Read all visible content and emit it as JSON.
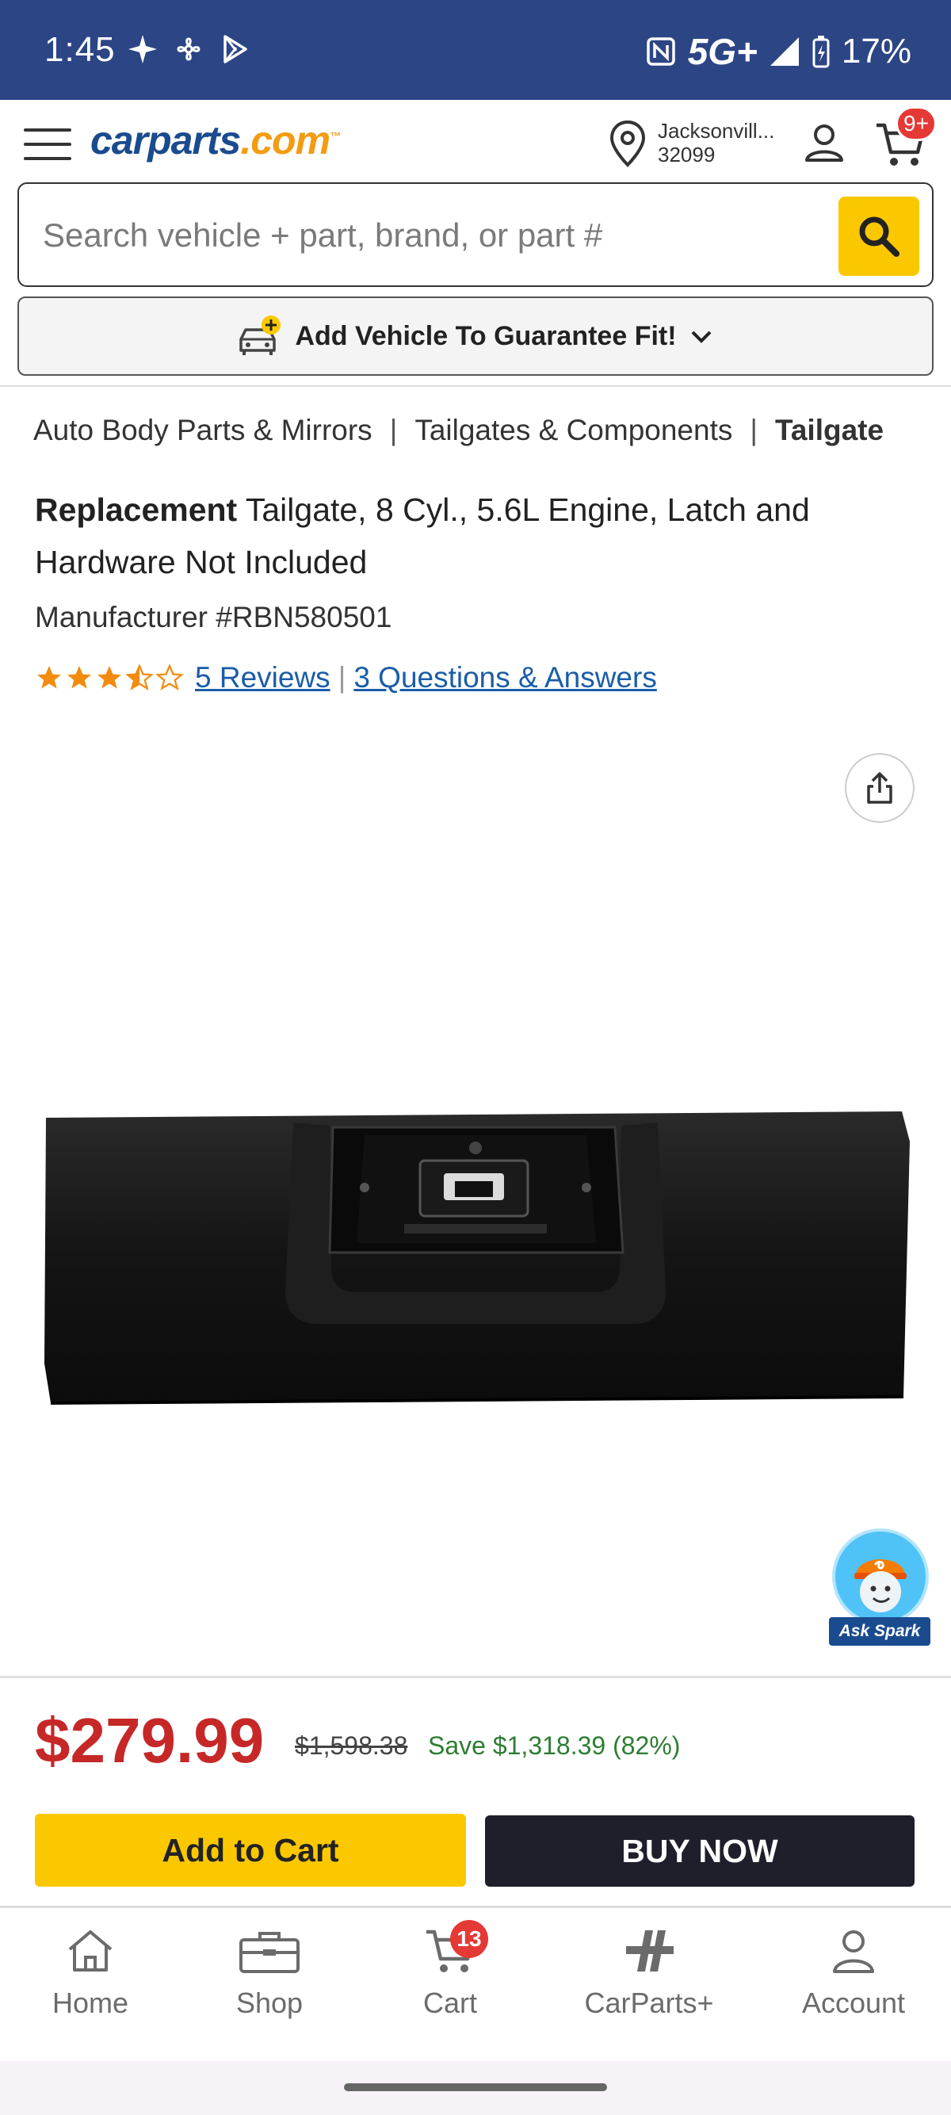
{
  "status_bar": {
    "time": "1:45",
    "network": "5G+",
    "battery": "17%"
  },
  "header": {
    "logo_car": "carparts",
    "logo_com": ".com",
    "logo_tm": "™",
    "location_city": "Jacksonvill...",
    "location_zip": "32099",
    "cart_count": "9+"
  },
  "search": {
    "placeholder": "Search vehicle + part, brand, or part #"
  },
  "vehicle_bar": {
    "label": "Add Vehicle To Guarantee Fit!"
  },
  "breadcrumb": {
    "items": [
      "Auto Body Parts & Mirrors",
      "Tailgates & Components",
      "Tailgate"
    ],
    "separator": "|"
  },
  "product": {
    "title_bold": "Replacement",
    "title_rest": " Tailgate, 8 Cyl., 5.6L Engine, Latch and Hardware Not Included",
    "manufacturer": "Manufacturer #RBN580501",
    "rating": 3.5,
    "reviews_link": "5 Reviews",
    "qa_link": "3 Questions & Answers"
  },
  "spark": {
    "label": "Ask Spark"
  },
  "pricing": {
    "price": "$279.99",
    "old_price": "$1,598.38",
    "save": "Save $1,318.39 (82%)"
  },
  "actions": {
    "add_to_cart": "Add to Cart",
    "buy_now": "BUY NOW"
  },
  "bottom_nav": {
    "home": "Home",
    "shop": "Shop",
    "cart": "Cart",
    "cart_count": "13",
    "carparts_plus": "CarParts+",
    "account": "Account"
  },
  "colors": {
    "status_bar": "#2c4585",
    "brand_blue": "#1a4b8f",
    "brand_orange": "#f39c12",
    "accent_yellow": "#fbc800",
    "price_red": "#c62828",
    "save_green": "#2e7d32",
    "link_blue": "#1a5da8",
    "star_orange": "#f28c0f"
  }
}
